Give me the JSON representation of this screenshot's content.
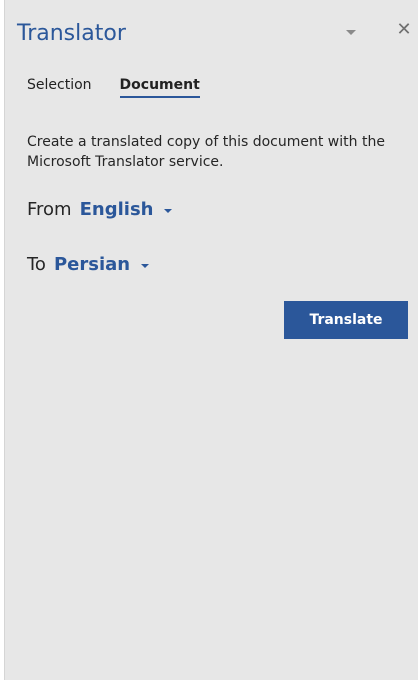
{
  "pane": {
    "title": "Translator",
    "options_icon": "chevron-down-icon",
    "close_icon": "close-icon",
    "close_glyph": "✕"
  },
  "tabs": [
    {
      "label": "Selection",
      "active": false
    },
    {
      "label": "Document",
      "active": true
    }
  ],
  "description": "Create a translated copy of this document with the Microsoft Translator service.",
  "from": {
    "label": "From",
    "value": "English"
  },
  "to": {
    "label": "To",
    "value": "Persian"
  },
  "actions": {
    "translate_label": "Translate"
  },
  "colors": {
    "accent": "#2b579a",
    "pane_background": "#e7e7e7"
  }
}
